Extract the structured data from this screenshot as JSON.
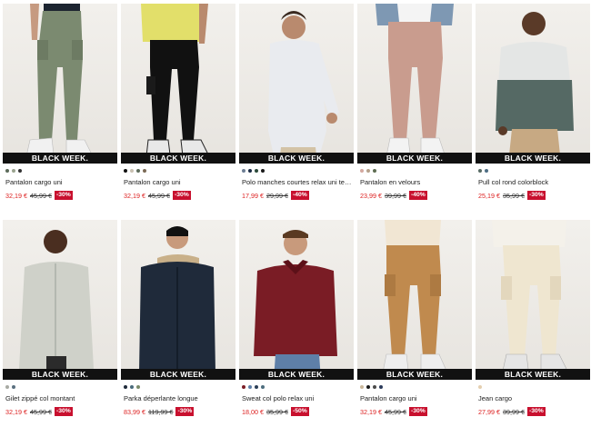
{
  "products": [
    {
      "banner": "BLACK WEEK.",
      "name": "Pantalon cargo uni",
      "price": "32,19 €",
      "old_price": "45,99 €",
      "discount": "-30%",
      "swatches": [
        "#5c6b5a",
        "#9aa38f",
        "#333"
      ]
    },
    {
      "banner": "BLACK WEEK.",
      "name": "Pantalon cargo uni",
      "price": "32,19 €",
      "old_price": "45,99 €",
      "discount": "-30%",
      "swatches": [
        "#111",
        "#c9c1b2",
        "#5c6b5a",
        "#7b6a55"
      ]
    },
    {
      "banner": "BLACK WEEK.",
      "name": "Polo manches courtes relax uni texturé",
      "price": "17,99 €",
      "old_price": "29,99 €",
      "discount": "-40%",
      "swatches": [
        "#6d7e94",
        "#1a2b44",
        "#2b4a3a",
        "#1a1a1a"
      ]
    },
    {
      "banner": "BLACK WEEK.",
      "name": "Pantalon en velours",
      "price": "23,99 €",
      "old_price": "39,99 €",
      "discount": "-40%",
      "swatches": [
        "#d4a9a0",
        "#b5a08a",
        "#5e6d52"
      ]
    },
    {
      "banner": "BLACK WEEK.",
      "name": "Pull col rond colorblock",
      "price": "25,19 €",
      "old_price": "35,99 €",
      "discount": "-30%",
      "swatches": [
        "#576b64",
        "#4e6e84"
      ]
    },
    {
      "banner": "BLACK WEEK.",
      "name": "Gilet zippé col montant",
      "price": "32,19 €",
      "old_price": "45,99 €",
      "discount": "-30%",
      "swatches": [
        "#a8aaa3",
        "#5a6f7f"
      ]
    },
    {
      "banner": "BLACK WEEK.",
      "name": "Parka déperlante longue",
      "price": "83,99 €",
      "old_price": "119,99 €",
      "discount": "-30%",
      "swatches": [
        "#1f2a3a",
        "#4a6b7c",
        "#7a8b6a"
      ]
    },
    {
      "banner": "BLACK WEEK.",
      "name": "Sweat col polo relax uni",
      "price": "18,00 €",
      "old_price": "35,99 €",
      "discount": "-50%",
      "swatches": [
        "#7a1c25",
        "#5e7fa8",
        "#2c3f57",
        "#4d6d7e"
      ]
    },
    {
      "banner": "BLACK WEEK.",
      "name": "Pantalon cargo uni",
      "price": "32,19 €",
      "old_price": "45,99 €",
      "discount": "-30%",
      "swatches": [
        "#cbb89c",
        "#1a1a1a",
        "#4a4a4a",
        "#2b3a5a"
      ]
    },
    {
      "banner": "BLACK WEEK.",
      "name": "Jean cargo",
      "price": "27,99 €",
      "old_price": "39,99 €",
      "discount": "-30%",
      "swatches": [
        "#e4cfb0"
      ]
    }
  ]
}
